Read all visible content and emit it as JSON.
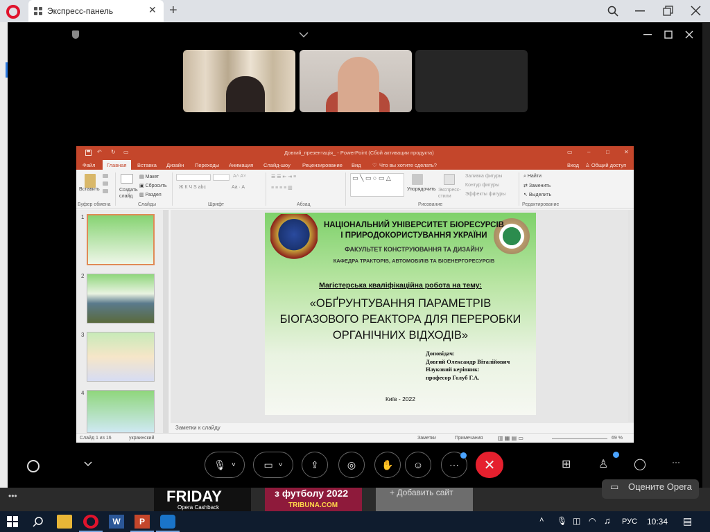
{
  "browser": {
    "tab_title": "Экспресс-панель",
    "new_tab_symbol": "+",
    "tab_close_symbol": "✕"
  },
  "meeting": {
    "participants": [
      {
        "id": "participant-1",
        "video": "on"
      },
      {
        "id": "participant-2",
        "video": "on"
      },
      {
        "id": "participant-3",
        "video": "off"
      }
    ]
  },
  "powerpoint": {
    "title": "Довгий_презентація_ - PowerPoint (Сбой активации продукта)",
    "tabs": [
      "Файл",
      "Главная",
      "Вставка",
      "Дизайн",
      "Переходы",
      "Анимация",
      "Слайд-шоу",
      "Рецензирование",
      "Вид"
    ],
    "tell_me": "Что вы хотите сделать?",
    "signin": "Вход",
    "share": "Общий доступ",
    "ribbon": {
      "paste": "Вставить",
      "clipboard": "Буфер обмена",
      "create_slide": "Создать слайд",
      "layout": "Макет",
      "reset": "Сбросить",
      "section": "Раздел",
      "slides": "Слайды",
      "font": "Шрифт",
      "paragraph": "Абзац",
      "arrange": "Упорядочить",
      "quick_styles": "Экспресс-стили",
      "drawing": "Рисование",
      "shape_fill": "Заливка фигуры",
      "shape_outline": "Контур фигуры",
      "shape_effects": "Эффекты фигуры",
      "find": "Найти",
      "replace": "Заменить",
      "select": "Выделить",
      "editing": "Редактирование"
    },
    "thumbnails": [
      "1",
      "2",
      "3",
      "4"
    ],
    "slide": {
      "univ_line1": "НАЦІОНАЛЬНИЙ УНІВЕРСИТЕТ БІОРЕСУРСІВ",
      "univ_line2": "І ПРИРОДОКОРИСТУВАННЯ УКРАЇНИ",
      "faculty": "ФАКУЛЬТЕТ КОНСТРУЮВАННЯ ТА ДИЗАЙНУ",
      "department": "КАФЕДРА ТРАКТОРІВ, АВТОМОБІЛІВ ТА БІОЕНЕРГОРЕСУРСІВ",
      "work_type": "Магістерська кваліфікаційна робота на тему:",
      "topic_line1": "«ОБҐРУНТУВАННЯ ПАРАМЕТРІВ",
      "topic_line2": "БІОГАЗОВОГО РЕАКТОРА ДЛЯ ПЕРЕРОБКИ",
      "topic_line3": "ОРГАНІЧНИХ ВІДХОДІВ»",
      "speaker_label": "Доповідач:",
      "speaker_name": "Довгий Олександр Віталійович",
      "supervisor_label": "Науковий керівник:",
      "supervisor_name": "професор Голуб Г.А.",
      "city_year": "Київ - 2022"
    },
    "notes_placeholder": "Заметки к слайду",
    "status": {
      "slide_of": "Слайд 1 из 16",
      "language": "украинский",
      "notes": "Заметки",
      "comments": "Примечания",
      "zoom": "69 %"
    }
  },
  "webpage": {
    "ad1_title": "FRIDAY",
    "ad1_sub": "Opera Cashback",
    "ad2_title": "з футболу 2022",
    "ad2_sub": "TRIBUNA.COM",
    "ad3_text": "+ Добавить сайт",
    "rate_opera": "Оцените Opera",
    "more": "•••"
  },
  "taskbar": {
    "lang": "РУС",
    "time": "10:34"
  },
  "colors": {
    "ppt_accent": "#c4462b",
    "leave_button": "#e5202e",
    "opera_red": "#e0132c"
  }
}
